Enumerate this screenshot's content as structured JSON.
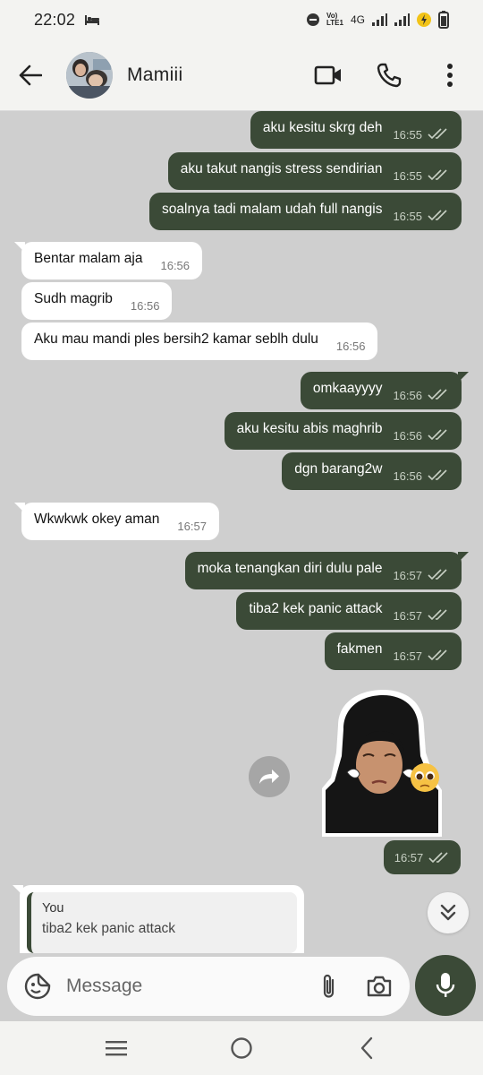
{
  "status_bar": {
    "time": "22:02",
    "network_label": "Vo) LTE1",
    "network_type": "4G"
  },
  "header": {
    "contact_name": "Mamiii",
    "icons": [
      "back-arrow-icon",
      "video-call-icon",
      "phone-icon",
      "more-vert-icon"
    ]
  },
  "messages": [
    {
      "dir": "out",
      "text": "aku kesitu skrg deh",
      "time": "16:55",
      "ticks": "double-check"
    },
    {
      "dir": "out",
      "text": "aku takut nangis stress sendirian",
      "time": "16:55",
      "ticks": "double-check"
    },
    {
      "dir": "out",
      "text": "soalnya tadi malam udah full nangis",
      "time": "16:55",
      "ticks": "double-check"
    },
    {
      "dir": "in",
      "text": "Bentar malam aja",
      "time": "16:56"
    },
    {
      "dir": "in",
      "text": "Sudh magrib",
      "time": "16:56"
    },
    {
      "dir": "in",
      "text": "Aku mau mandi ples bersih2 kamar seblh dulu",
      "time": "16:56"
    },
    {
      "dir": "out",
      "text": "omkaayyyy",
      "time": "16:56",
      "ticks": "double-check"
    },
    {
      "dir": "out",
      "text": "aku kesitu abis maghrib",
      "time": "16:56",
      "ticks": "double-check"
    },
    {
      "dir": "out",
      "text": "dgn barang2w",
      "time": "16:56",
      "ticks": "double-check"
    },
    {
      "dir": "in",
      "text": "Wkwkwk okey aman",
      "time": "16:57"
    },
    {
      "dir": "out",
      "text": "moka tenangkan diri dulu pale",
      "time": "16:57",
      "ticks": "double-check"
    },
    {
      "dir": "out",
      "text": "tiba2 kek panic attack",
      "time": "16:57",
      "ticks": "double-check"
    },
    {
      "dir": "out",
      "text": "fakmen",
      "time": "16:57",
      "ticks": "double-check"
    }
  ],
  "sticker": {
    "time": "16:57",
    "ticks": "double-check",
    "emoji": "🥺"
  },
  "reply_preview": {
    "author": "You",
    "text": "tiba2 kek panic attack"
  },
  "composer": {
    "placeholder": "Message"
  },
  "colors": {
    "outgoing_bubble": "#3b4a37",
    "incoming_bubble": "#ffffff",
    "chat_background": "#cfcfcf",
    "bar_background": "#f3f3f1"
  }
}
